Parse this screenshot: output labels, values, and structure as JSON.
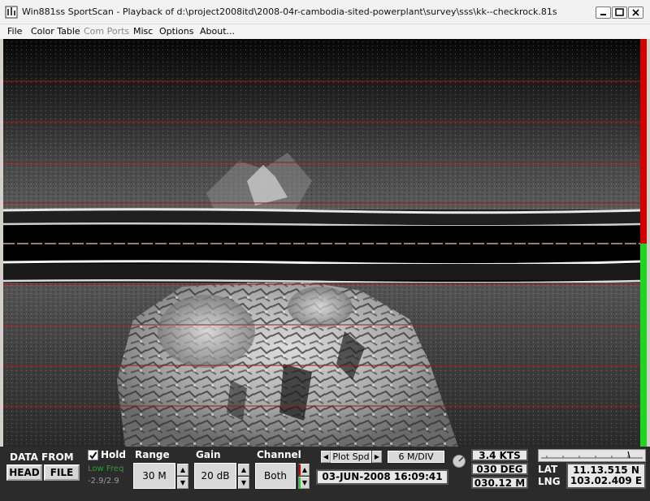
{
  "window": {
    "title": "Win881ss SportScan - Playback of d:\\project2008itd\\2008-04r-cambodia-sited-powerplant\\survey\\sss\\kk--checkrock.81s"
  },
  "menu": [
    "File",
    "Color Table",
    "Com Ports",
    "Misc",
    "Options",
    "About..."
  ],
  "menu_disabled": [
    "Com Ports"
  ],
  "sonar": {
    "strip_colors": {
      "top": "#d40000",
      "bottom": "#1fd51f"
    },
    "range_line_color": "#b01414"
  },
  "panel": {
    "data_from_label": "DATA FROM",
    "head_button": "HEAD",
    "file_button": "FILE",
    "hold_label": "Hold",
    "hold_checked": true,
    "low_freq_label": "Low Freq",
    "low_freq_value": "-2.9/2.9",
    "range_label": "Range",
    "range_value": "30 M",
    "gain_label": "Gain",
    "gain_value": "20 dB",
    "channel_label": "Channel",
    "channel_value": "Both",
    "plot_spd_label": "Plot Spd",
    "div_value": "6 M/DIV",
    "datetime": "03-JUN-2008  16:09:41",
    "speed": "3.4 KTS",
    "heading": "030 DEG",
    "depth": "030.12 M",
    "lat_label": "LAT",
    "lng_label": "LNG",
    "lat_value": "11.13.515 N",
    "lng_value": "103.02.409 E"
  }
}
